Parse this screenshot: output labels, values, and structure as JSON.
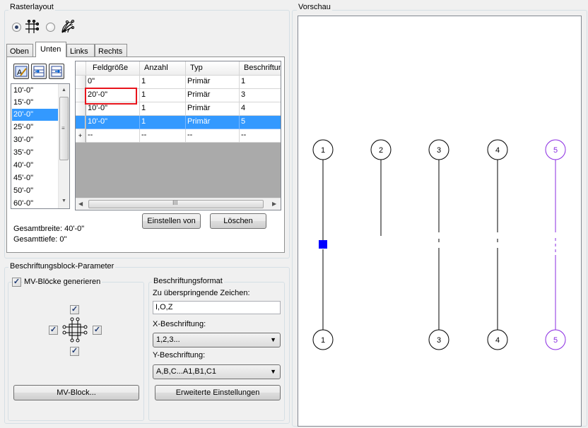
{
  "raster": {
    "group_title": "Rasterlayout",
    "mode_rect_icon": "rectangular-grid-icon",
    "mode_radial_icon": "radial-grid-icon",
    "tabs": [
      {
        "label": "Oben"
      },
      {
        "label": "Unten"
      },
      {
        "label": "Links"
      },
      {
        "label": "Rechts"
      }
    ],
    "active_tab": "Unten",
    "toolbar_icons": [
      "edit-label-icon",
      "insert-row-icon",
      "copy-row-icon"
    ],
    "bay_sizes": [
      "10'-0\"",
      "15'-0\"",
      "20'-0\"",
      "25'-0\"",
      "30'-0\"",
      "35'-0\"",
      "40'-0\"",
      "45'-0\"",
      "50'-0\"",
      "60'-0\""
    ],
    "selected_bay_size": "20'-0\"",
    "table": {
      "headers": [
        "Feldgröße",
        "Anzahl",
        "Typ",
        "Beschriftun"
      ],
      "rows": [
        [
          "0\"",
          "1",
          "Primär",
          "1"
        ],
        [
          "20'-0\"",
          "1",
          "Primär",
          "3"
        ],
        [
          "10'-0\"",
          "1",
          "Primär",
          "4"
        ],
        [
          "10'-0\"",
          "1",
          "Primär",
          "5"
        ],
        [
          "--",
          "--",
          "--",
          "--"
        ]
      ],
      "new_row_marker": "+",
      "selected_row": 3
    },
    "set_from_button": "Einstellen von",
    "delete_button": "Löschen",
    "total_width_label": "Gesamtbreite:",
    "total_width_value": "40'-0\"",
    "total_depth_label": "Gesamttiefe:",
    "total_depth_value": "0\""
  },
  "label_params": {
    "group_title": "Beschriftungsblock-Parameter",
    "generate_mv_label": "MV-Blöcke generieren",
    "generate_mv_checked": true,
    "mv_block_button": "MV-Block...",
    "format": {
      "title": "Beschriftungsformat",
      "skip_chars_label": "Zu überspringende Zeichen:",
      "skip_chars_value": "I,O,Z",
      "x_label": "X-Beschriftung:",
      "x_value": "1,2,3...",
      "y_label": "Y-Beschriftung:",
      "y_value": "A,B,C...A1,B1,C1",
      "advanced_button": "Erweiterte Einstellungen"
    }
  },
  "preview": {
    "title": "Vorschau",
    "line_color": "#000000",
    "selected_line_color": "#8a2be2",
    "grip_color": "#0000ff",
    "top_bubbles": [
      "1",
      "2",
      "3",
      "4",
      "5"
    ],
    "bottom_bubbles": [
      "1",
      "3",
      "4",
      "5"
    ]
  }
}
